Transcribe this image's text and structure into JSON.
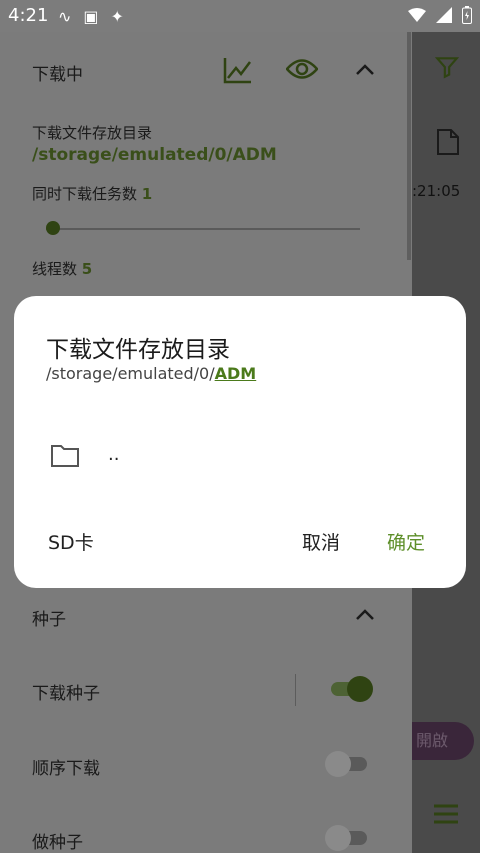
{
  "status_bar": {
    "time": "4:21"
  },
  "background_app": {
    "time_fragment": ":21:05",
    "start_button_label": "開啟"
  },
  "panel": {
    "downloading_section": {
      "title": "下载中"
    },
    "download_dir_label": "下载文件存放目录",
    "download_dir_path": "/storage/emulated/0/ADM",
    "concurrent_tasks_label": "同时下载任务数",
    "concurrent_tasks_value": "1",
    "threads_label": "线程数",
    "threads_value": "5",
    "torrent_section": {
      "title": "种子"
    },
    "download_torrent_label": "下载种子",
    "sequential_download_label": "顺序下载",
    "seeding_label": "做种子",
    "download_torrent_enabled": true,
    "sequential_download_enabled": false,
    "seeding_enabled": false
  },
  "dialog": {
    "title": "下载文件存放目录",
    "breadcrumb_prefix": "/storage/emulated/0/",
    "breadcrumb_current": "ADM",
    "parent_folder_name": "..",
    "sd_button": "SD卡",
    "cancel_button": "取消",
    "ok_button": "确定"
  },
  "colors": {
    "accent": "#5e8f2a",
    "accent_dark": "#3a4f1a",
    "scrim_panel": "#7b7b7b",
    "dialog_bg": "#ffffff"
  }
}
